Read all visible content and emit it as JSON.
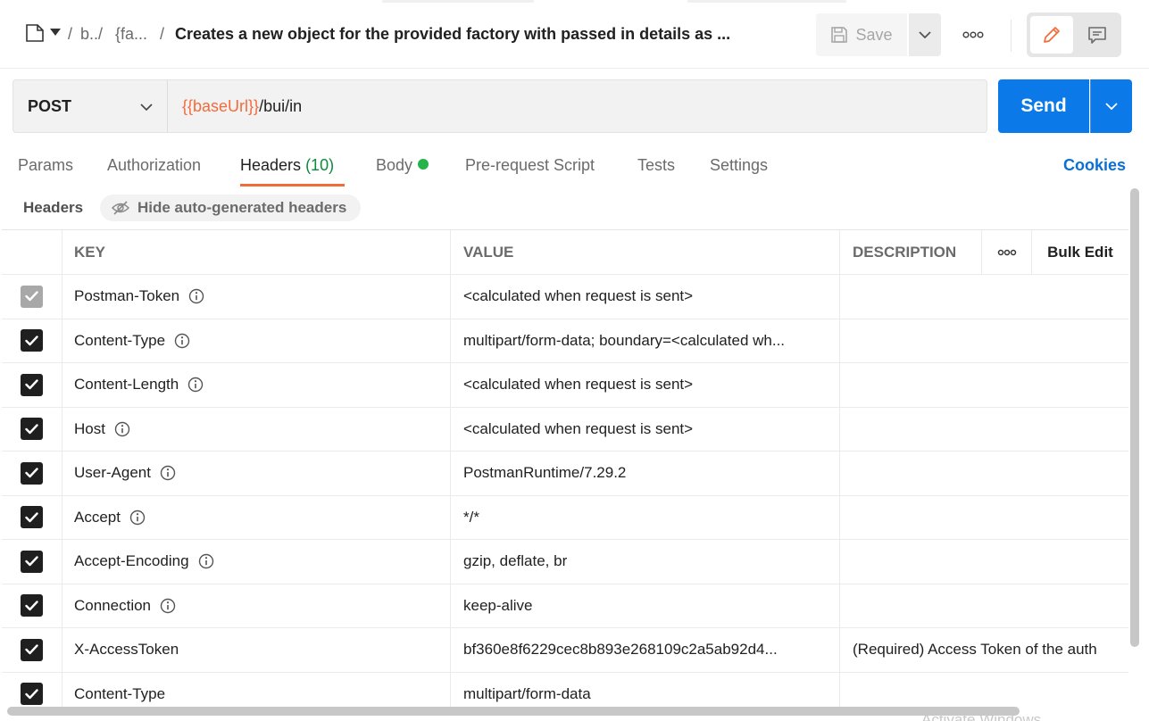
{
  "breadcrumb": {
    "part1": "b../",
    "part2": "{fa...",
    "separator": "/",
    "title": "Creates a new object for the provided factory with passed in details as ..."
  },
  "toolbar": {
    "save_label": "Save"
  },
  "request": {
    "method": "POST",
    "url_variable": "{{baseUrl}}",
    "url_path": "/bui/in",
    "send_label": "Send"
  },
  "tabs": {
    "params": "Params",
    "authorization": "Authorization",
    "headers": "Headers",
    "headers_count": "(10)",
    "body": "Body",
    "pre_request": "Pre-request Script",
    "tests": "Tests",
    "settings": "Settings",
    "cookies": "Cookies"
  },
  "headers_section": {
    "label": "Headers",
    "hide_auto_label": "Hide auto-generated headers"
  },
  "table": {
    "columns": {
      "key": "KEY",
      "value": "VALUE",
      "description": "DESCRIPTION",
      "bulk_edit": "Bulk Edit"
    },
    "rows": [
      {
        "key": "Postman-Token",
        "value": "<calculated when request is sent>",
        "description": ""
      },
      {
        "key": "Content-Type",
        "value": "multipart/form-data; boundary=<calculated wh...",
        "description": ""
      },
      {
        "key": "Content-Length",
        "value": "<calculated when request is sent>",
        "description": ""
      },
      {
        "key": "Host",
        "value": "<calculated when request is sent>",
        "description": ""
      },
      {
        "key": "User-Agent",
        "value": "PostmanRuntime/7.29.2",
        "description": ""
      },
      {
        "key": "Accept",
        "value": "*/*",
        "description": ""
      },
      {
        "key": "Accept-Encoding",
        "value": "gzip, deflate, br",
        "description": ""
      },
      {
        "key": "Connection",
        "value": "keep-alive",
        "description": ""
      },
      {
        "key": "X-AccessToken",
        "value": "bf360e8f6229cec8b893e268109c2a5ab92d4...",
        "description": "(Required) Access Token of the auth"
      },
      {
        "key": "Content-Type",
        "value": "multipart/form-data",
        "description": ""
      }
    ]
  },
  "watermark": "Activate Windows",
  "colors": {
    "accent": "#f26b3a",
    "send": "#0b7ae8",
    "cookies": "#0b6fd6",
    "count": "#0e8a3e",
    "body_dot": "#26b34a"
  }
}
